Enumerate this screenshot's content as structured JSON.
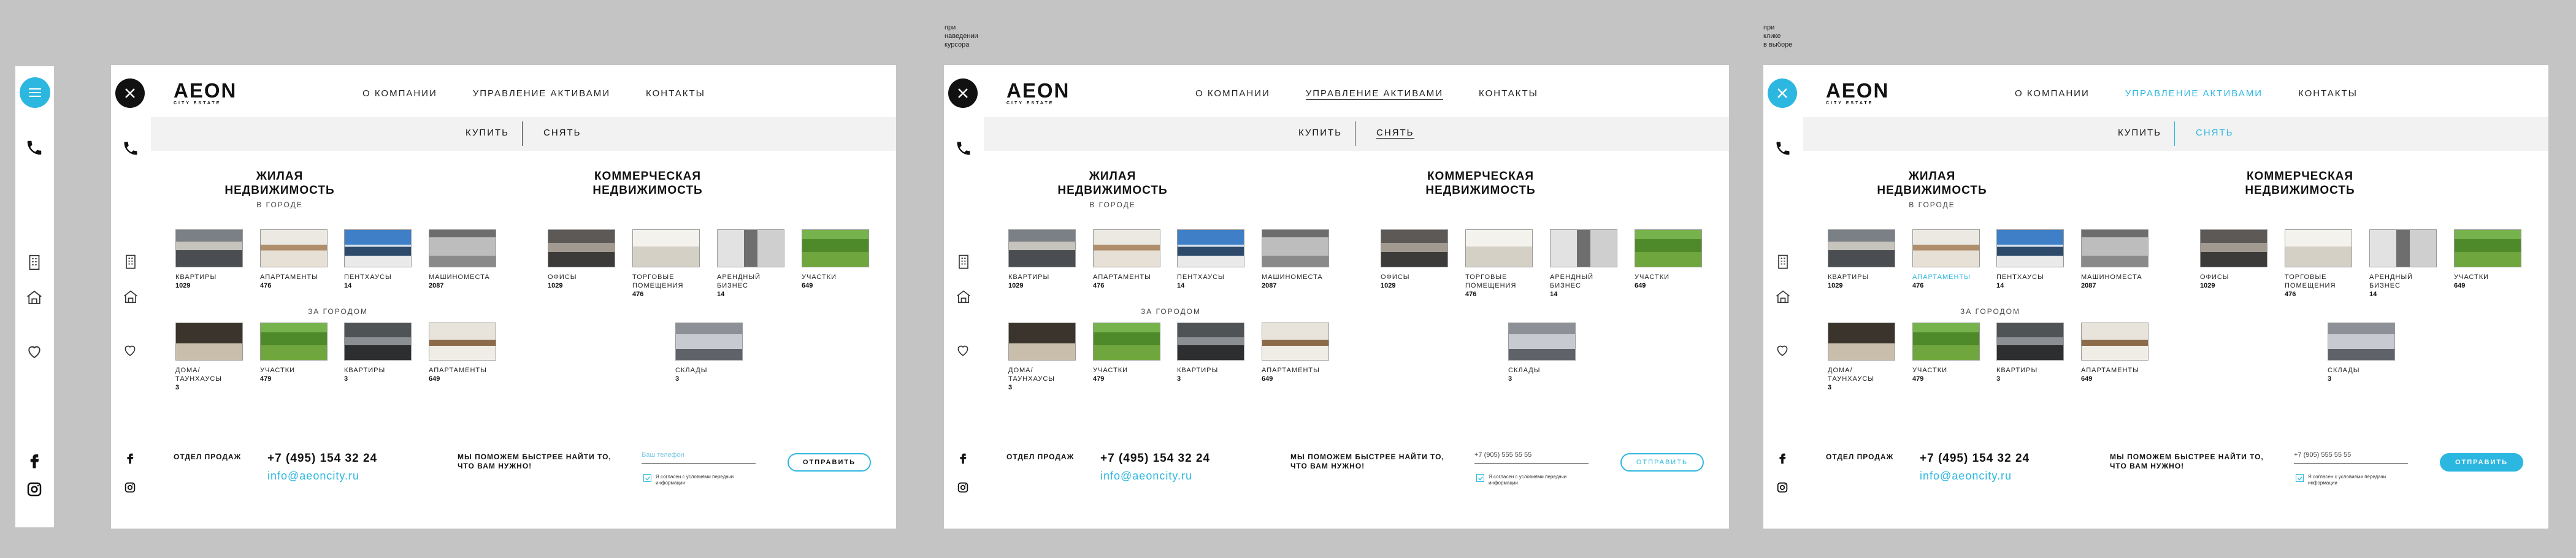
{
  "brand": {
    "logo": "AEON",
    "tagline": "CITY ESTATE"
  },
  "notes": {
    "hover": "при\nнаведении\nкурсора",
    "click": "при\nклике\nв выборе"
  },
  "nav": [
    "О КОМПАНИИ",
    "УПРАВЛЕНИЕ АКТИВАМИ",
    "КОНТАКТЫ"
  ],
  "modes": {
    "buy": "КУПИТЬ",
    "rent": "СНЯТЬ"
  },
  "residential": {
    "title": "ЖИЛАЯ\nНЕДВИЖИМОСТЬ",
    "city_label": "В ГОРОДЕ",
    "country_label": "ЗА ГОРОДОМ"
  },
  "commercial": {
    "title": "КОММЕРЧЕСКАЯ\nНЕДВИЖИМОСТЬ"
  },
  "city_items": [
    {
      "label": "КВАРТИРЫ",
      "count": "1029"
    },
    {
      "label": "АПАРТАМЕНТЫ",
      "count": "476"
    },
    {
      "label": "ПЕНТХАУСЫ",
      "count": "14"
    },
    {
      "label": "МАШИНОМЕСТА",
      "count": "2087"
    }
  ],
  "commercial_items": [
    {
      "label": "ОФИСЫ",
      "count": "1029"
    },
    {
      "label": "ТОРГОВЫЕ\nПОМЕЩЕНИЯ",
      "count": "476"
    },
    {
      "label": "АРЕНДНЫЙ\nБИЗНЕС",
      "count": "14"
    },
    {
      "label": "УЧАСТКИ",
      "count": "649"
    }
  ],
  "country_items": [
    {
      "label": "ДОМА/\nТАУНХАУСЫ",
      "count": "3"
    },
    {
      "label": "УЧАСТКИ",
      "count": "479"
    },
    {
      "label": "КВАРТИРЫ",
      "count": "3"
    },
    {
      "label": "АПАРТАМЕНТЫ",
      "count": "649"
    }
  ],
  "warehouse": {
    "label": "СКЛАДЫ",
    "count": "3"
  },
  "footer": {
    "sales_label": "ОТДЕЛ ПРОДАЖ",
    "phone": "+7 (495) 154 32 24",
    "email": "info@aeoncity.ru",
    "help": "МЫ ПОМОЖЕМ БЫСТРЕЕ  НАЙТИ ТО,\nЧТО ВАМ НУЖНО!",
    "phone_placeholder": "Ваш телефон",
    "phone_value": "+7 (905) 555 55 55",
    "consent": "Я согласен с условиями передачи\nинформации",
    "send": "ОТПРАВИТЬ"
  },
  "colors": {
    "accent": "#2cb7e0",
    "dark": "#111111",
    "band": "#f2f2f2"
  }
}
